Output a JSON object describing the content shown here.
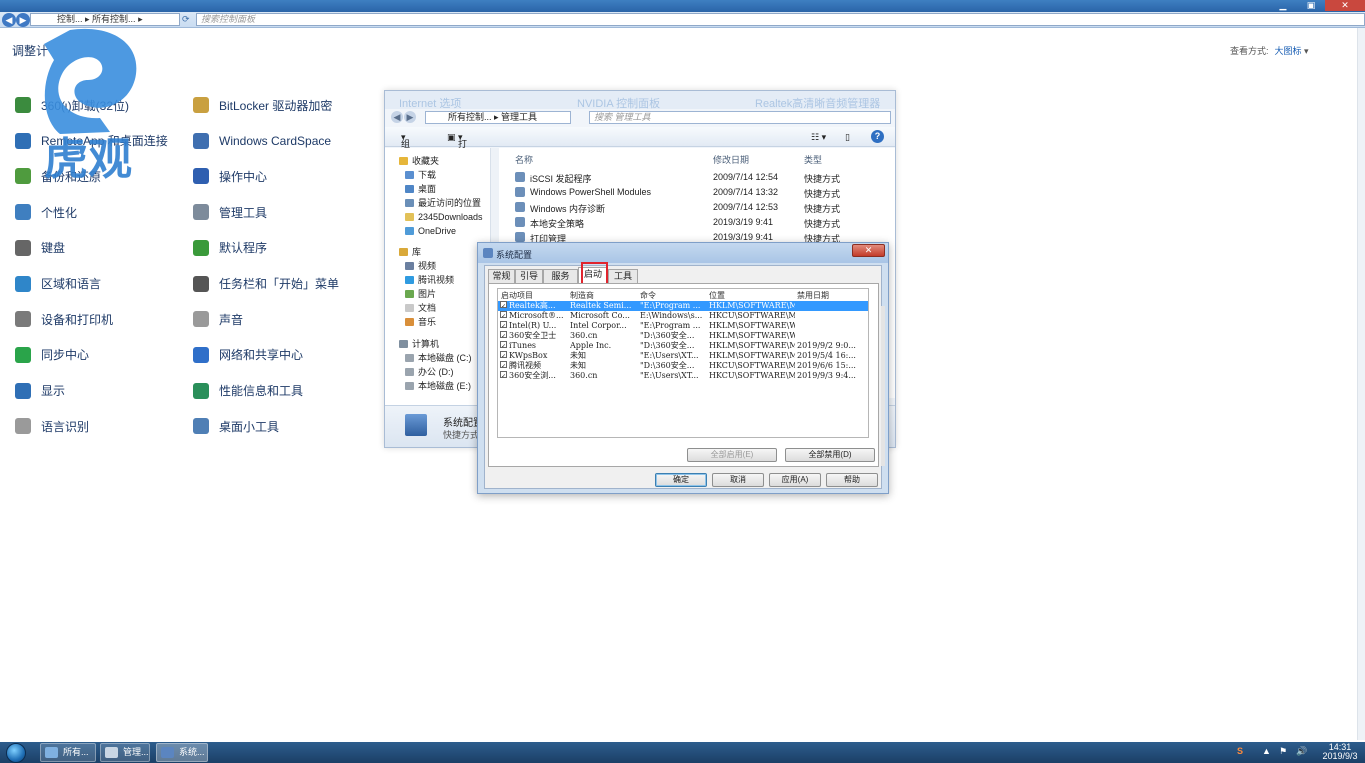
{
  "control_panel": {
    "address_segments": [
      "控制...",
      "所有控制..."
    ],
    "search_placeholder": "搜索控制面板",
    "header_partial": "调整计",
    "view_by_label": "查看方式:",
    "view_by_value": "大图标",
    "items_col1": [
      "360(ɩ)卸载(32位)",
      "RemoteApp 和桌面连接",
      "备份和还原",
      "个性化",
      "键盘",
      "区域和语言",
      "设备和打印机",
      "同步中心",
      "显示",
      "语言识别"
    ],
    "items_col2": [
      "BitLocker 驱动器加密",
      "Windows CardSpace",
      "操作中心",
      "管理工具",
      "默认程序",
      "任务栏和「开始」菜单",
      "声音",
      "网络和共享中心",
      "性能信息和工具",
      "桌面小工具"
    ],
    "icons_col1": [
      "uninstall-icon",
      "remote-desktop-icon",
      "backup-icon",
      "personalize-icon",
      "keyboard-icon",
      "region-icon",
      "printer-icon",
      "sync-icon",
      "display-icon",
      "microphone-icon"
    ],
    "icons_col2": [
      "bitlocker-icon",
      "cardspace-icon",
      "flag-icon",
      "admin-tools-icon",
      "default-programs-icon",
      "taskbar-icon",
      "sound-icon",
      "network-icon",
      "performance-icon",
      "gadgets-icon"
    ],
    "icon_colors_col1": [
      "#3b8b3e",
      "#2f6fb5",
      "#4f9b3e",
      "#3f7fc0",
      "#666666",
      "#2f86c9",
      "#7a7a7a",
      "#2aa44a",
      "#2f6fb5",
      "#9a9a9a"
    ],
    "icon_colors_col2": [
      "#c9a040",
      "#3f6fb0",
      "#2f5fb0",
      "#7d8b9b",
      "#3a9a3a",
      "#555555",
      "#9a9a9a",
      "#2f6fc9",
      "#2a8f5a",
      "#4f7fb5"
    ]
  },
  "logo": {
    "text": "虎观"
  },
  "explorer": {
    "ghost_titles": [
      "Internet 选项",
      "NVIDIA 控制面板",
      "Realtek高清晰音频管理器"
    ],
    "address_segments": [
      "所有控制...",
      "管理工具"
    ],
    "search_placeholder": "搜索 管理工具",
    "toolbar": {
      "organize": "组织",
      "open": "打开"
    },
    "nav": [
      "收藏夹",
      "下载",
      "桌面",
      "最近访问的位置",
      "2345Downloads",
      "OneDrive",
      "库",
      "视频",
      "腾讯视频",
      "图片",
      "文档",
      "音乐",
      "计算机",
      "本地磁盘 (C:)",
      "办公 (D:)",
      "本地磁盘 (E:)"
    ],
    "columns": {
      "name": "名称",
      "date": "修改日期",
      "type": "类型"
    },
    "rows": [
      {
        "name": "iSCSI 发起程序",
        "date": "2009/7/14 12:54",
        "type": "快捷方式"
      },
      {
        "name": "Windows PowerShell Modules",
        "date": "2009/7/14 13:32",
        "type": "快捷方式"
      },
      {
        "name": "Windows 内存诊断",
        "date": "2009/7/14 12:53",
        "type": "快捷方式"
      },
      {
        "name": "本地安全策略",
        "date": "2019/3/19 9:41",
        "type": "快捷方式"
      },
      {
        "name": "打印管理",
        "date": "2019/3/19 9:41",
        "type": "快捷方式"
      }
    ],
    "detail": {
      "name": "系统配置",
      "type": "快捷方式"
    }
  },
  "msconfig": {
    "title": "系统配置",
    "tabs": [
      "常规",
      "引导",
      "服务",
      "启动",
      "工具"
    ],
    "active_tab": "启动",
    "columns": [
      "启动项目",
      "制造商",
      "命令",
      "位置",
      "禁用日期"
    ],
    "rows": [
      {
        "item": "Realtek高...",
        "maker": "Realtek Semi...",
        "cmd": "\"E:\\Program ...",
        "loc": "HKLM\\SOFTWARE\\Mi...",
        "date": ""
      },
      {
        "item": "Microsoft®...",
        "maker": "Microsoft Co...",
        "cmd": "E:\\Windows\\s...",
        "loc": "HKCU\\SOFTWARE\\Mi...",
        "date": ""
      },
      {
        "item": "Intel(R) U...",
        "maker": "Intel Corpor...",
        "cmd": "\"E:\\Program ...",
        "loc": "HKLM\\SOFTWARE\\Wo...",
        "date": ""
      },
      {
        "item": "360安全卫士",
        "maker": "360.cn",
        "cmd": "\"D:\\360安全...",
        "loc": "HKLM\\SOFTWARE\\Wo...",
        "date": ""
      },
      {
        "item": "iTunes",
        "maker": "Apple Inc.",
        "cmd": "\"D:\\360安全...",
        "loc": "HKLM\\SOFTWARE\\Mi...",
        "date": "2019/9/2 9:0..."
      },
      {
        "item": "KWpsBox",
        "maker": "未知",
        "cmd": "\"E:\\Users\\XT...",
        "loc": "HKLM\\SOFTWARE\\Mi...",
        "date": "2019/5/4 16:..."
      },
      {
        "item": "腾讯视频",
        "maker": "未知",
        "cmd": "\"D:\\360安全...",
        "loc": "HKCU\\SOFTWARE\\Mi...",
        "date": "2019/6/6 15:..."
      },
      {
        "item": "360安全浏...",
        "maker": "360.cn",
        "cmd": "\"E:\\Users\\XT...",
        "loc": "HKCU\\SOFTWARE\\Mi...",
        "date": "2019/9/3 9:4..."
      }
    ],
    "enable_all": "全部启用(E)",
    "disable_all": "全部禁用(D)",
    "ok": "确定",
    "cancel": "取消",
    "apply": "应用(A)",
    "help": "帮助"
  },
  "taskbar": {
    "buttons": [
      "所有...",
      "管理...",
      "系统..."
    ],
    "clock_time": "14:31",
    "clock_date": "2019/9/3"
  }
}
